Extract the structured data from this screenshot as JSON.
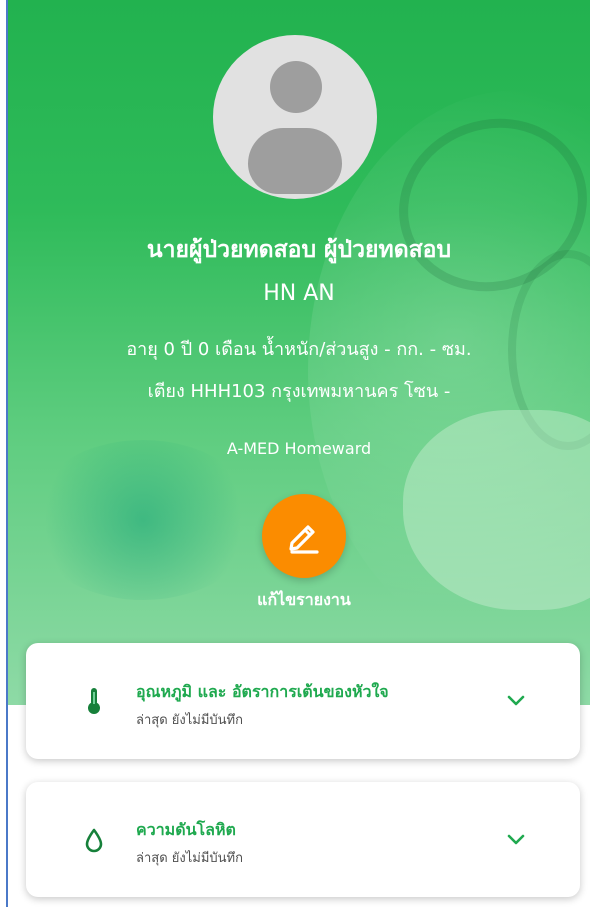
{
  "profile": {
    "avatar_icon": "user-avatar-icon",
    "name": "นายผู้ป่วยทดสอบ ผู้ป่วยทดสอบ",
    "hn": "HN AN",
    "age_line": "อายุ 0 ปี 0 เดือน น้ำหนัก/ส่วนสูง - กก. - ซม.",
    "bed_line": "เตียง HHH103 กรุงเทพมหานคร โซน -",
    "organization": "A-MED Homeward"
  },
  "edit": {
    "icon": "edit-pencil-icon",
    "label": "แก้ไขรายงาน"
  },
  "cards": [
    {
      "icon": "thermometer-icon",
      "title": "อุณหภูมิ และ อัตราการเต้นของหัวใจ",
      "subtitle": "ล่าสุด ยังไม่มีบันทึก"
    },
    {
      "icon": "blood-drop-icon",
      "title": "ความดันโลหิต",
      "subtitle": "ล่าสุด ยังไม่มีบันทึก"
    }
  ],
  "colors": {
    "primary_green": "#22b24f",
    "accent_orange": "#fb8c00",
    "card_title_green": "#1fa94f",
    "icon_green": "#16803a"
  }
}
